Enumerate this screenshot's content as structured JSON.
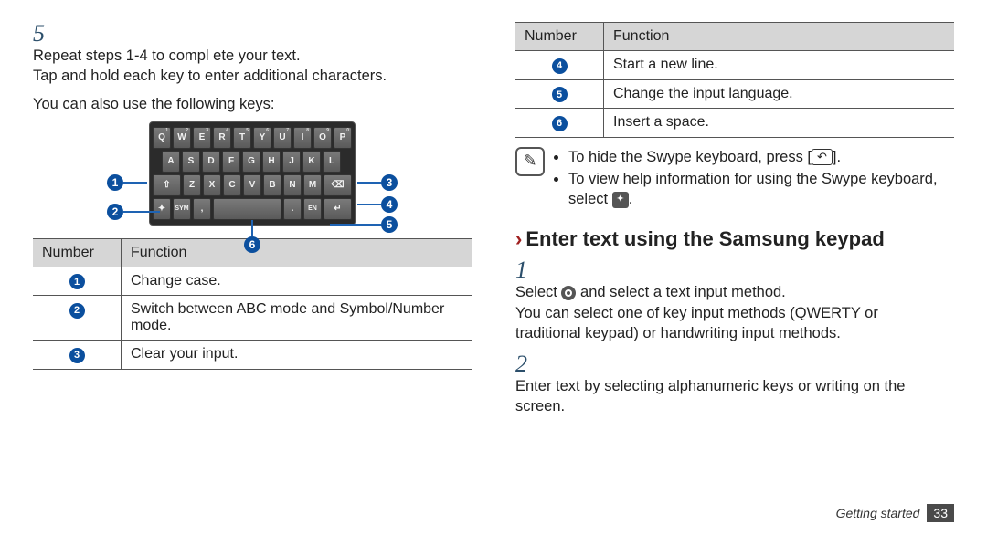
{
  "left": {
    "step5_num": "5",
    "step5_line1": "Repeat steps 1-4 to compl ete your text.",
    "step5_line2": "Tap and hold each key to enter additional characters.",
    "also": "You can also use the following keys:",
    "keyboard": {
      "row1": [
        "Q",
        "W",
        "E",
        "R",
        "T",
        "Y",
        "U",
        "I",
        "O",
        "P"
      ],
      "row1_sup": [
        "1",
        "2",
        "3",
        "4",
        "5",
        "6",
        "7",
        "8",
        "9",
        "0"
      ],
      "row2": [
        "A",
        "S",
        "D",
        "F",
        "G",
        "H",
        "J",
        "K",
        "L"
      ],
      "row3_shift": "⇧",
      "row3": [
        "Z",
        "X",
        "C",
        "V",
        "B",
        "N",
        "M"
      ],
      "row3_del": "⌫",
      "row4_swype": "✦",
      "row4_sym": "SYM",
      "row4_comma": ",",
      "row4_period": ".",
      "row4_lang": "EN",
      "row4_enter": "↵"
    },
    "callouts": {
      "c1": "1",
      "c2": "2",
      "c3": "3",
      "c4": "4",
      "c5": "5",
      "c6": "6"
    },
    "table": {
      "h1": "Number",
      "h2": "Function",
      "rows": [
        {
          "n": "1",
          "f": "Change case."
        },
        {
          "n": "2",
          "f": "Switch between ABC mode and Symbol/Number mode."
        },
        {
          "n": "3",
          "f": "Clear your input."
        }
      ]
    }
  },
  "right": {
    "table": {
      "h1": "Number",
      "h2": "Function",
      "rows": [
        {
          "n": "4",
          "f": "Start a new line."
        },
        {
          "n": "5",
          "f": "Change the input language."
        },
        {
          "n": "6",
          "f": "Insert a space."
        }
      ]
    },
    "note": {
      "icon": "✎",
      "b1a": "To hide the Swype keyboard, press [",
      "b1_key": "↶",
      "b1b": "].",
      "b2a": "To view help information for using the Swype keyboard, select ",
      "b2_icon": "✦",
      "b2b": "."
    },
    "heading_chev": "›",
    "heading": "Enter text using the Samsung keypad",
    "step1_num": "1",
    "step1_a": "Select ",
    "step1_b": " and select a text input method.",
    "step1_line2": "You can select one of key input methods (QWERTY or traditional keypad) or handwriting input methods.",
    "step2_num": "2",
    "step2": "Enter text by selecting alphanumeric keys or writing on the screen."
  },
  "footer": {
    "section": "Getting started",
    "page": "33"
  }
}
